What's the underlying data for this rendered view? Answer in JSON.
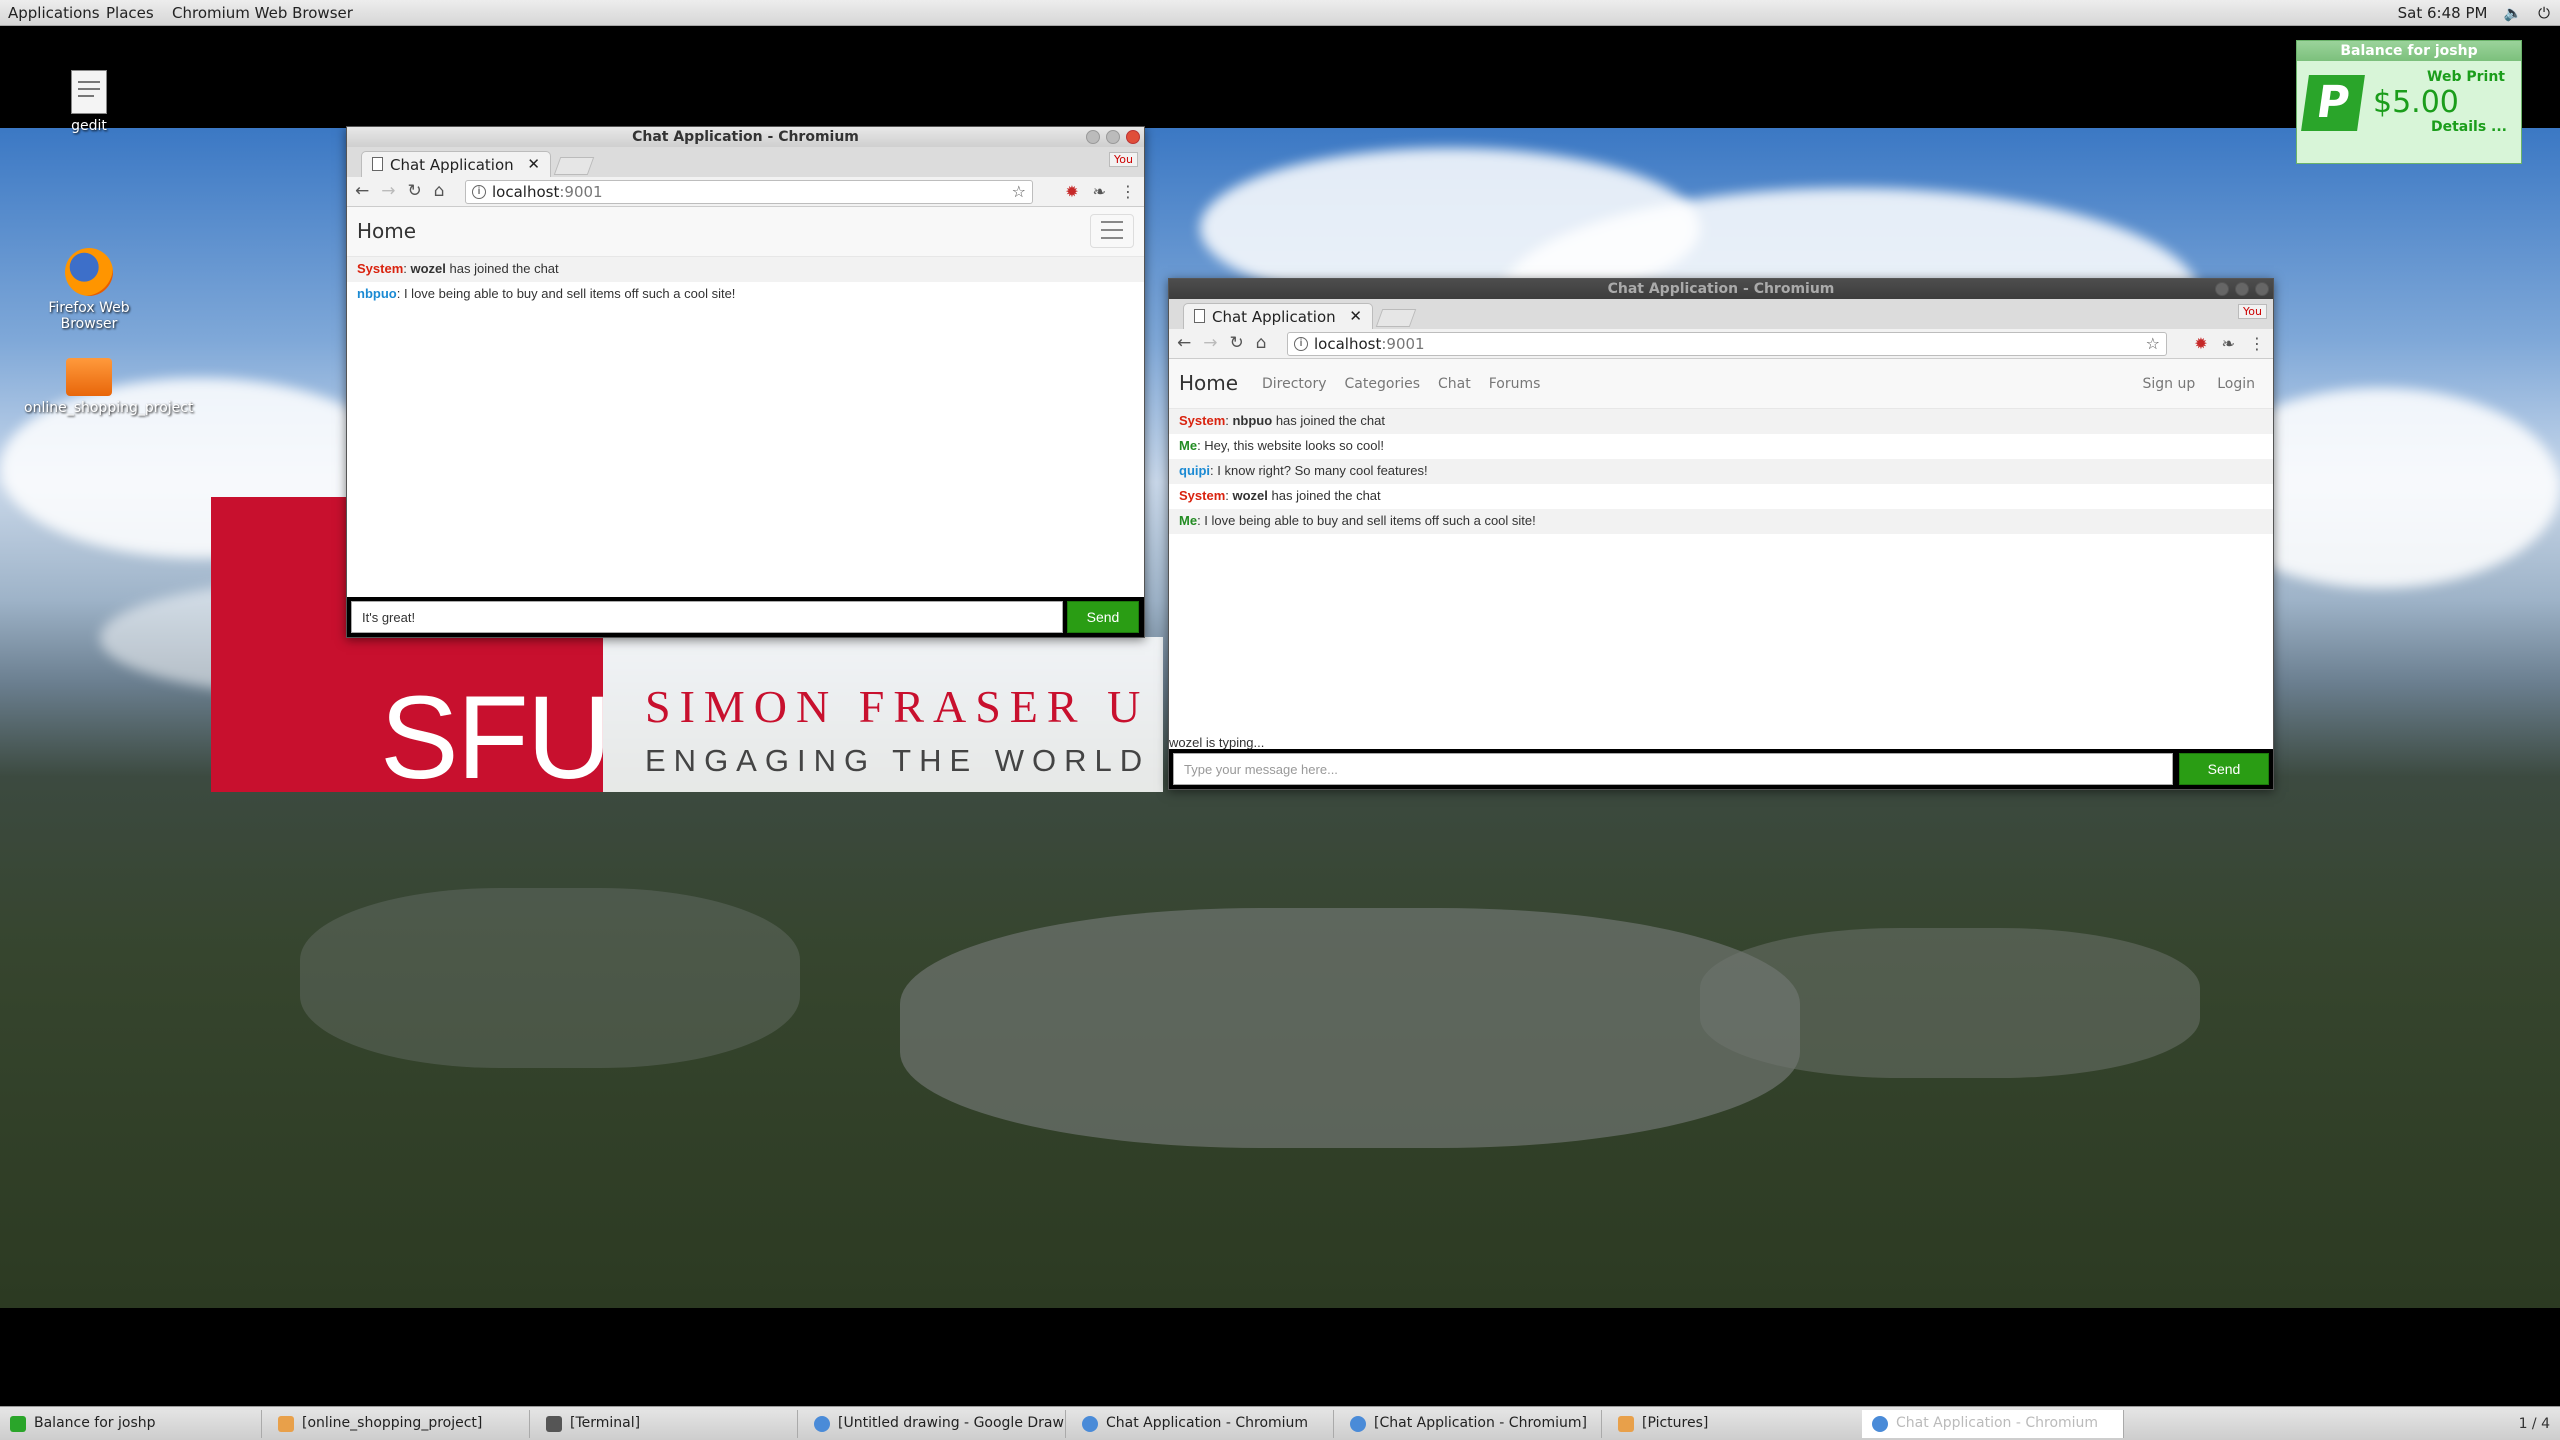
{
  "top_panel": {
    "menus": [
      "Applications",
      "Places",
      "Chromium Web Browser"
    ],
    "clock": "Sat  6:48 PM"
  },
  "desktop_icons": [
    {
      "label": "gedit"
    },
    {
      "label": "Firefox Web Browser"
    },
    {
      "label": "online_shopping_project"
    }
  ],
  "wallpaper": {
    "logo": "SFU",
    "name": "SIMON FRASER U",
    "tagline": "ENGAGING THE WORLD"
  },
  "balance_widget": {
    "title": "Balance for joshp",
    "service": "Web Print",
    "amount": "$5.00",
    "details": "Details ..."
  },
  "window_left": {
    "title": "Chat Application - Chromium",
    "tab_label": "Chat Application",
    "url_host": "localhost",
    "url_port": ":9001",
    "profile": "You",
    "brand": "Home",
    "messages": [
      {
        "who": "System",
        "kind": "system",
        "user": "wozel",
        "text": " has joined the chat"
      },
      {
        "who": "nbpuo",
        "kind": "other",
        "user": "",
        "text": "I love being able to buy and sell items off such a cool site!"
      }
    ],
    "input_value": "It's great!",
    "send_label": "Send"
  },
  "window_right": {
    "title": "Chat Application - Chromium",
    "tab_label": "Chat Application",
    "url_host": "localhost",
    "url_port": ":9001",
    "profile": "You",
    "brand": "Home",
    "nav": [
      "Directory",
      "Categories",
      "Chat",
      "Forums"
    ],
    "nav_right": [
      "Sign up",
      "Login"
    ],
    "messages": [
      {
        "who": "System",
        "kind": "system",
        "user": "nbpuo",
        "text": " has joined the chat"
      },
      {
        "who": "Me",
        "kind": "me",
        "user": "",
        "text": "Hey, this website looks so cool!"
      },
      {
        "who": "quipi",
        "kind": "other",
        "user": "",
        "text": "I know right? So many cool features!"
      },
      {
        "who": "System",
        "kind": "system",
        "user": "wozel",
        "text": " has joined the chat"
      },
      {
        "who": "Me",
        "kind": "me",
        "user": "",
        "text": "I love being able to buy and sell items off such a cool site!"
      }
    ],
    "typing": "wozel is typing...",
    "input_placeholder": "Type your message here...",
    "send_label": "Send"
  },
  "taskbar": {
    "items": [
      "Balance for joshp",
      "[online_shopping_project]",
      "[Terminal]",
      "[Untitled drawing - Google Drawing...",
      "Chat Application - Chromium",
      "[Chat Application - Chromium]",
      "[Pictures]",
      "Chat Application - Chromium"
    ],
    "pager": "1 / 4"
  },
  "colors": {
    "system": "#d9230f",
    "me": "#238c23",
    "other": "#1b8ad3",
    "send": "#2a9d14",
    "sfu_red": "#c8102e"
  }
}
